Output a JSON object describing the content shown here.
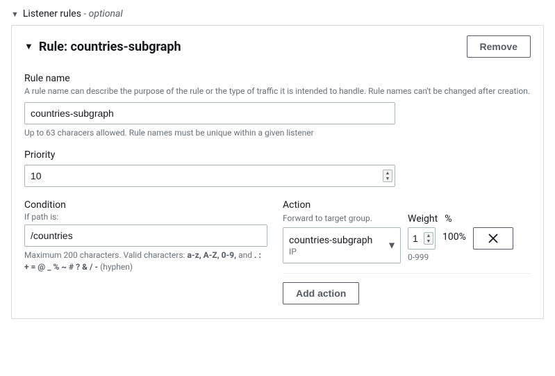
{
  "section": {
    "title": "Listener rules",
    "optional_suffix": " - optional"
  },
  "rule": {
    "header_prefix": "Rule: ",
    "header_name": "countries-subgraph",
    "remove_label": "Remove",
    "ruleName": {
      "label": "Rule name",
      "description": "A rule name can describe the purpose of the rule or the type of traffic it is intended to handle. Rule names can't be changed after creation.",
      "value": "countries-subgraph",
      "hint": "Up to 63 characers allowed. Rule names must be unique within a given listener"
    },
    "priority": {
      "label": "Priority",
      "value": "10"
    },
    "condition": {
      "label": "Condition",
      "sublabel": "If path is:",
      "value": "/countries",
      "hint_prefix": "Maximum 200 characters. Valid characters: ",
      "hint_bold": "a-z, A-Z, 0-9,",
      "hint_mid": " and ",
      "hint_bold2": ". : + = @ _ % ~ # ? & / -",
      "hint_suffix": " (hyphen)"
    },
    "action": {
      "label": "Action",
      "sublabel": "Forward to target group.",
      "target_group_value": "countries-subgraph",
      "target_group_type": "IP",
      "weight_label": "Weight",
      "weight_value": "1",
      "weight_hint": "0-999",
      "percent_label": "%",
      "percent_value": "100%",
      "add_action_label": "Add action"
    }
  }
}
